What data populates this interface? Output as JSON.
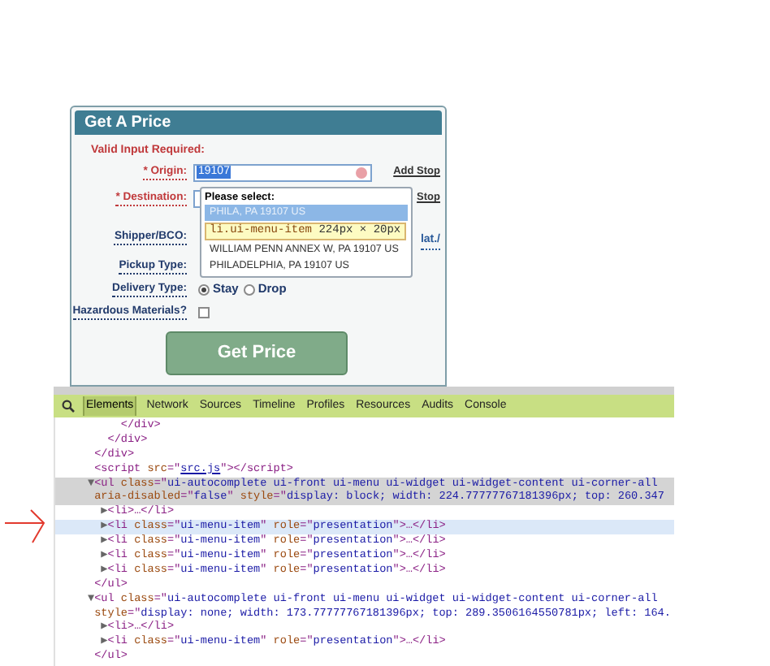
{
  "form": {
    "title": "Get A Price",
    "notice": "Valid Input Required:",
    "fields": [
      {
        "kind": "text",
        "label": "* Origin:",
        "required": true,
        "value": "19107",
        "value_highlighted": true,
        "link": "Add Stop"
      },
      {
        "kind": "text",
        "label": "* Destination:",
        "required": true,
        "link": "Stop"
      },
      {
        "kind": "text",
        "label": "Shipper/BCO:",
        "required": false,
        "link": "lat./"
      },
      {
        "kind": "select",
        "label": "Pickup Type:",
        "required": false
      },
      {
        "kind": "radio",
        "label": "Delivery Type:",
        "required": false,
        "options": [
          {
            "label": "Stay",
            "selected": true
          },
          {
            "label": "Drop",
            "selected": false
          }
        ]
      },
      {
        "kind": "checkbox",
        "label": "Hazardous Materials?",
        "required": false,
        "checked": false
      }
    ],
    "submit": "Get Price",
    "autocomplete": {
      "heading": "Please select:",
      "items": [
        {
          "label": "PHILA, PA 19107 US",
          "selected": true
        },
        {
          "label": "WILLIAM PENN ANNEX W, PA 19107 US",
          "selected": false
        },
        {
          "label": "PHILADELPHIA, PA 19107 US",
          "selected": false
        }
      ],
      "tooltip": {
        "selector": "li.ui-menu-item",
        "size": "224px × 20px"
      }
    }
  },
  "devtools": {
    "tabs": [
      {
        "label": "Elements",
        "selected": true
      },
      {
        "label": "Network",
        "selected": false
      },
      {
        "label": "Sources",
        "selected": false
      },
      {
        "label": "Timeline",
        "selected": false
      },
      {
        "label": "Profiles",
        "selected": false
      },
      {
        "label": "Resources",
        "selected": false
      },
      {
        "label": "Audits",
        "selected": false
      },
      {
        "label": "Console",
        "selected": false
      }
    ],
    "lines": [
      {
        "selected": false,
        "hovered": false,
        "segments": [
          {
            "kind": "tag",
            "text": "     </div>"
          }
        ]
      },
      {
        "selected": false,
        "hovered": false,
        "segments": [
          {
            "kind": "tag",
            "text": "   </div>"
          }
        ]
      },
      {
        "selected": false,
        "hovered": false,
        "segments": [
          {
            "kind": "tag",
            "text": " </div>"
          }
        ]
      },
      {
        "selected": false,
        "hovered": false,
        "segments": [
          {
            "kind": "tag",
            "text": " <script "
          },
          {
            "kind": "attr",
            "text": "src"
          },
          {
            "kind": "tag",
            "text": "=\""
          },
          {
            "kind": "link",
            "text": "src.js"
          },
          {
            "kind": "tag",
            "text": "\"></script>"
          }
        ]
      },
      {
        "selected": true,
        "hovered": false,
        "segments": [
          {
            "kind": "toggle",
            "text": "▼"
          },
          {
            "kind": "tag",
            "text": "<ul "
          },
          {
            "kind": "attr",
            "text": "class"
          },
          {
            "kind": "tag",
            "text": "=\""
          },
          {
            "kind": "value",
            "text": "ui-autocomplete ui-front ui-menu ui-widget ui-widget-content ui-corner-all"
          }
        ]
      },
      {
        "selected": true,
        "hovered": false,
        "segments": [
          {
            "kind": "attr",
            "text": " aria-disabled"
          },
          {
            "kind": "tag",
            "text": "=\""
          },
          {
            "kind": "value",
            "text": "false"
          },
          {
            "kind": "tag",
            "text": "\" "
          },
          {
            "kind": "attr",
            "text": "style"
          },
          {
            "kind": "tag",
            "text": "=\""
          },
          {
            "kind": "value",
            "text": "display: block; width: 224.77777767181396px; top: 260.347"
          }
        ]
      },
      {
        "selected": false,
        "hovered": false,
        "segments": [
          {
            "kind": "toggle",
            "text": "  ▶"
          },
          {
            "kind": "tag",
            "text": "<li>…</li>"
          }
        ]
      },
      {
        "selected": false,
        "hovered": true,
        "segments": [
          {
            "kind": "toggle",
            "text": "  ▶"
          },
          {
            "kind": "tag",
            "text": "<li "
          },
          {
            "kind": "attr",
            "text": "class"
          },
          {
            "kind": "tag",
            "text": "=\""
          },
          {
            "kind": "value",
            "text": "ui-menu-item"
          },
          {
            "kind": "tag",
            "text": "\" "
          },
          {
            "kind": "attr",
            "text": "role"
          },
          {
            "kind": "tag",
            "text": "=\""
          },
          {
            "kind": "value",
            "text": "presentation"
          },
          {
            "kind": "tag",
            "text": "\">…</li>"
          }
        ]
      },
      {
        "selected": false,
        "hovered": false,
        "segments": [
          {
            "kind": "toggle",
            "text": "  ▶"
          },
          {
            "kind": "tag",
            "text": "<li "
          },
          {
            "kind": "attr",
            "text": "class"
          },
          {
            "kind": "tag",
            "text": "=\""
          },
          {
            "kind": "value",
            "text": "ui-menu-item"
          },
          {
            "kind": "tag",
            "text": "\" "
          },
          {
            "kind": "attr",
            "text": "role"
          },
          {
            "kind": "tag",
            "text": "=\""
          },
          {
            "kind": "value",
            "text": "presentation"
          },
          {
            "kind": "tag",
            "text": "\">…</li>"
          }
        ]
      },
      {
        "selected": false,
        "hovered": false,
        "segments": [
          {
            "kind": "toggle",
            "text": "  ▶"
          },
          {
            "kind": "tag",
            "text": "<li "
          },
          {
            "kind": "attr",
            "text": "class"
          },
          {
            "kind": "tag",
            "text": "=\""
          },
          {
            "kind": "value",
            "text": "ui-menu-item"
          },
          {
            "kind": "tag",
            "text": "\" "
          },
          {
            "kind": "attr",
            "text": "role"
          },
          {
            "kind": "tag",
            "text": "=\""
          },
          {
            "kind": "value",
            "text": "presentation"
          },
          {
            "kind": "tag",
            "text": "\">…</li>"
          }
        ]
      },
      {
        "selected": false,
        "hovered": false,
        "segments": [
          {
            "kind": "toggle",
            "text": "  ▶"
          },
          {
            "kind": "tag",
            "text": "<li "
          },
          {
            "kind": "attr",
            "text": "class"
          },
          {
            "kind": "tag",
            "text": "=\""
          },
          {
            "kind": "value",
            "text": "ui-menu-item"
          },
          {
            "kind": "tag",
            "text": "\" "
          },
          {
            "kind": "attr",
            "text": "role"
          },
          {
            "kind": "tag",
            "text": "=\""
          },
          {
            "kind": "value",
            "text": "presentation"
          },
          {
            "kind": "tag",
            "text": "\">…</li>"
          }
        ]
      },
      {
        "selected": false,
        "hovered": false,
        "segments": [
          {
            "kind": "tag",
            "text": " </ul>"
          }
        ]
      },
      {
        "selected": false,
        "hovered": false,
        "segments": [
          {
            "kind": "toggle",
            "text": "▼"
          },
          {
            "kind": "tag",
            "text": "<ul "
          },
          {
            "kind": "attr",
            "text": "class"
          },
          {
            "kind": "tag",
            "text": "=\""
          },
          {
            "kind": "value",
            "text": "ui-autocomplete ui-front ui-menu ui-widget ui-widget-content ui-corner-all"
          }
        ]
      },
      {
        "selected": false,
        "hovered": false,
        "segments": [
          {
            "kind": "attr",
            "text": " style"
          },
          {
            "kind": "tag",
            "text": "=\""
          },
          {
            "kind": "value",
            "text": "display: none; width: 173.77777767181396px; top: 289.3506164550781px; left: 164."
          }
        ]
      },
      {
        "selected": false,
        "hovered": false,
        "segments": [
          {
            "kind": "toggle",
            "text": "  ▶"
          },
          {
            "kind": "tag",
            "text": "<li>…</li>"
          }
        ]
      },
      {
        "selected": false,
        "hovered": false,
        "segments": [
          {
            "kind": "toggle",
            "text": "  ▶"
          },
          {
            "kind": "tag",
            "text": "<li "
          },
          {
            "kind": "attr",
            "text": "class"
          },
          {
            "kind": "tag",
            "text": "=\""
          },
          {
            "kind": "value",
            "text": "ui-menu-item"
          },
          {
            "kind": "tag",
            "text": "\" "
          },
          {
            "kind": "attr",
            "text": "role"
          },
          {
            "kind": "tag",
            "text": "=\""
          },
          {
            "kind": "value",
            "text": "presentation"
          },
          {
            "kind": "tag",
            "text": "\">…</li>"
          }
        ]
      },
      {
        "selected": false,
        "hovered": false,
        "segments": [
          {
            "kind": "tag",
            "text": " </ul>"
          }
        ]
      }
    ]
  }
}
